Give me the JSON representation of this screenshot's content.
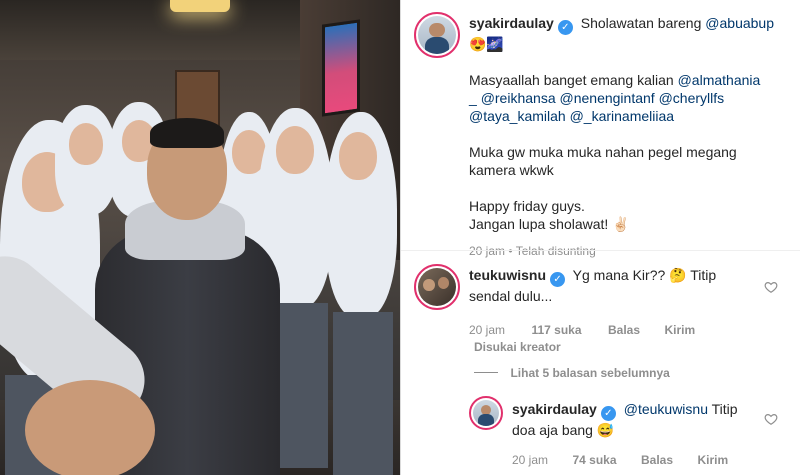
{
  "post": {
    "username": "syakirdaulay",
    "caption_intro": "Sholawatan bareng",
    "caption_mention": "@abuabup",
    "caption_emoji": "😍🌌",
    "para1_text": "Masyaallah banget emang kalian",
    "para1_mentions": [
      "@almathania",
      "_",
      "@reikhansa",
      "@nenengintanf",
      "@cheryllfs",
      "@taya_kamilah",
      "@_karinameliiaa"
    ],
    "para2_line1": "Muka gw muka muka nahan pegel megang",
    "para2_line2": "kamera wkwk",
    "para3_line1": "Happy friday guys.",
    "para3_line2": "Jangan lupa sholawat! ✌🏻",
    "timestamp": "20 jam",
    "edited": "Telah disunting"
  },
  "comments": [
    {
      "username": "teukuwisnu",
      "text_line1": "Yg mana Kir?? 🤔 Titip",
      "text_line2": "sendal dulu...",
      "time": "20 jam",
      "likes": "117 suka",
      "reply_label": "Balas",
      "send_label": "Kirim",
      "creator_liked": "Disukai kreator",
      "view_replies": "Lihat 5 balasan sebelumnya"
    },
    {
      "username": "syakirdaulay",
      "mention": "@teukuwisnu",
      "text_line1_rest": "Titip",
      "text_line2": "doa aja bang 😅",
      "time": "20 jam",
      "likes": "74 suka",
      "reply_label": "Balas",
      "send_label": "Kirim"
    }
  ],
  "icons": {
    "verified": "verified-badge-icon",
    "heart": "heart-icon"
  },
  "colors": {
    "verified": "#3897f0",
    "mention": "#00376b",
    "meta": "#8e8e8e",
    "story_ring": "#e1306c"
  }
}
